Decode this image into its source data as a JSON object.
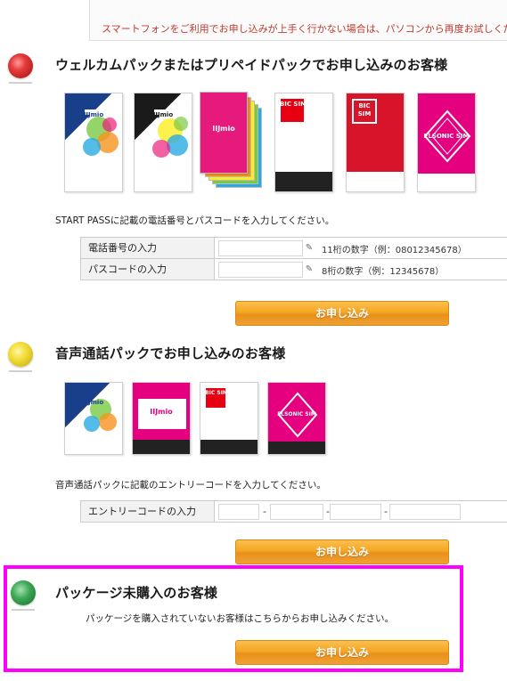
{
  "notice": {
    "text": "スマートフォンをご利用でお申し込みが上手く行かない場合は、パソコンから再度お試しくだ"
  },
  "colors": {
    "accent_orange": "#f5a623",
    "notice_red": "#c0392b",
    "highlight": "#ff00ff"
  },
  "sections": {
    "welcome": {
      "bullet_color": "red",
      "title": "ウェルカムパックまたはプリペイドパックでお申し込みのお客様",
      "instruction": "START PASSに記載の電話番号とパスコードを入力してください。",
      "fields": [
        {
          "label": "電話番号の入力",
          "hint": "11桁の数字（例：08012345678）",
          "value": ""
        },
        {
          "label": "パスコードの入力",
          "hint": "8桁の数字（例：12345678）",
          "value": ""
        }
      ],
      "button": "お申し込み",
      "cards": [
        {
          "name": "IIJmio welcome pack",
          "text": "IIJmio"
        },
        {
          "name": "IIJmio welcome pack black",
          "text": "IIJmio"
        },
        {
          "name": "IIJmio prepaid pack stack",
          "text": "IIJmio"
        },
        {
          "name": "BIC SIM white",
          "text": "BIC SIM"
        },
        {
          "name": "BIC SIM red",
          "text": "BIC SIM"
        },
        {
          "name": "ELSONIC SIM",
          "text": "ELSONIC SIM"
        }
      ]
    },
    "voice": {
      "bullet_color": "yellow",
      "title": "音声通話パックでお申し込みのお客様",
      "instruction": "音声通話パックに記載のエントリーコードを入力してください。",
      "field_label": "エントリーコードの入力",
      "button": "お申し込み",
      "cards": [
        {
          "name": "IIJmio voice pack",
          "text": "IIJmio"
        },
        {
          "name": "IIJmio voice pack pink",
          "text": "IIJmio"
        },
        {
          "name": "BIC SIM voice",
          "text": "BIC SIM"
        },
        {
          "name": "ELSONIC SIM voice",
          "text": "ELSONIC SIM"
        }
      ]
    },
    "no_package": {
      "bullet_color": "green",
      "title": "パッケージ未購入のお客様",
      "description": "パッケージを購入されていないお客様はこちらからお申し込みください。",
      "button": "お申し込み"
    }
  }
}
